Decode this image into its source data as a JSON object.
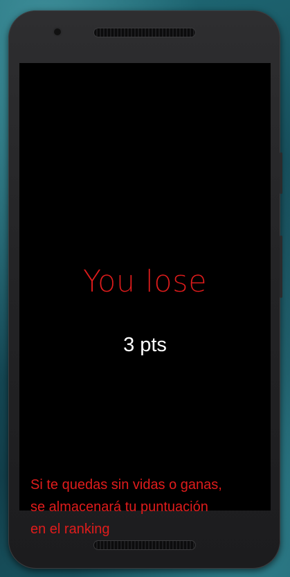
{
  "game_over": {
    "title": "You lose",
    "score": "3 pts"
  },
  "hint": {
    "line1": "Si te quedas sin vidas o ganas,",
    "line2": "se almacenará tu puntuación",
    "line3": "en el ranking"
  },
  "colors": {
    "accent_red": "#e01c1c",
    "score_text": "#ffffff",
    "screen_background": "#000000"
  }
}
